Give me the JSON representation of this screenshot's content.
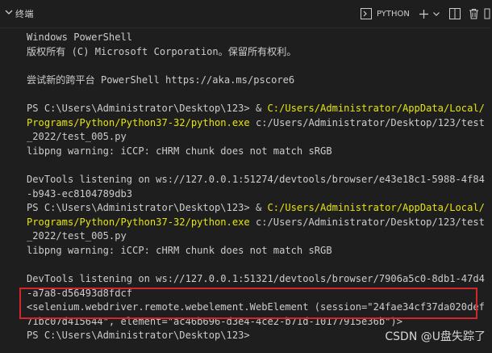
{
  "header": {
    "title": "终端",
    "shell_label": "PYTHON",
    "icons": [
      "chevron-down-icon",
      "terminal-icon",
      "plus-icon",
      "dropdown-icon",
      "split-icon",
      "trash-icon",
      "more-icon"
    ]
  },
  "terminal": {
    "lines": [
      {
        "segments": [
          {
            "text": "Windows PowerShell",
            "style": "normal"
          }
        ]
      },
      {
        "segments": [
          {
            "text": "版权所有 (C) Microsoft Corporation。保留所有权利。",
            "style": "normal"
          }
        ]
      },
      {
        "segments": [
          {
            "text": "",
            "style": "normal"
          }
        ]
      },
      {
        "segments": [
          {
            "text": "尝试新的跨平台 PowerShell https://aka.ms/pscore6",
            "style": "normal"
          }
        ]
      },
      {
        "segments": [
          {
            "text": "",
            "style": "normal"
          }
        ]
      },
      {
        "segments": [
          {
            "text": "PS C:\\Users\\Administrator\\Desktop\\123> & ",
            "style": "normal"
          },
          {
            "text": "C:/Users/Administrator/AppData/Local/",
            "style": "yellow"
          }
        ]
      },
      {
        "segments": [
          {
            "text": "Programs/Python/Python37-32/python.exe",
            "style": "yellow"
          },
          {
            "text": " c:/Users/Administrator/Desktop/123/test",
            "style": "normal"
          }
        ]
      },
      {
        "segments": [
          {
            "text": "_2022/test_005.py",
            "style": "normal"
          }
        ]
      },
      {
        "segments": [
          {
            "text": "libpng warning: iCCP: cHRM chunk does not match sRGB",
            "style": "normal"
          }
        ]
      },
      {
        "segments": [
          {
            "text": "",
            "style": "normal"
          }
        ]
      },
      {
        "segments": [
          {
            "text": "DevTools listening on ws://127.0.0.1:51274/devtools/browser/e43e18c1-5988-4f84",
            "style": "normal"
          }
        ]
      },
      {
        "segments": [
          {
            "text": "-b943-ec8104789db3",
            "style": "normal"
          }
        ]
      },
      {
        "segments": [
          {
            "text": "PS C:\\Users\\Administrator\\Desktop\\123> & ",
            "style": "normal"
          },
          {
            "text": "C:/Users/Administrator/AppData/Local/",
            "style": "yellow"
          }
        ]
      },
      {
        "segments": [
          {
            "text": "Programs/Python/Python37-32/python.exe",
            "style": "yellow"
          },
          {
            "text": " c:/Users/Administrator/Desktop/123/test",
            "style": "normal"
          }
        ]
      },
      {
        "segments": [
          {
            "text": "_2022/test_005.py",
            "style": "normal"
          }
        ]
      },
      {
        "segments": [
          {
            "text": "libpng warning: iCCP: cHRM chunk does not match sRGB",
            "style": "normal"
          }
        ]
      },
      {
        "segments": [
          {
            "text": "",
            "style": "normal"
          }
        ]
      },
      {
        "segments": [
          {
            "text": "DevTools listening on ws://127.0.0.1:51321/devtools/browser/7906a5c0-8db1-47d4",
            "style": "normal"
          }
        ]
      },
      {
        "segments": [
          {
            "text": "-a7a8-d56493d8fdcf",
            "style": "normal"
          }
        ]
      },
      {
        "segments": [
          {
            "text": "<selenium.webdriver.remote.webelement.WebElement (session=\"24fae34cf37da020def",
            "style": "normal"
          }
        ]
      },
      {
        "segments": [
          {
            "text": "71bc07d415644\", element=\"ac46b696-d3e4-4ce2-b71d-10177915e36b\")>",
            "style": "normal"
          }
        ]
      },
      {
        "segments": [
          {
            "text": "PS C:\\Users\\Administrator\\Desktop\\123>",
            "style": "normal"
          }
        ]
      }
    ]
  },
  "watermark": "CSDN @U盘失踪了",
  "colors": {
    "background": "#1e1e1e",
    "text": "#cccccc",
    "path_highlight": "#e5e510",
    "annotation_box": "#d0262c"
  }
}
